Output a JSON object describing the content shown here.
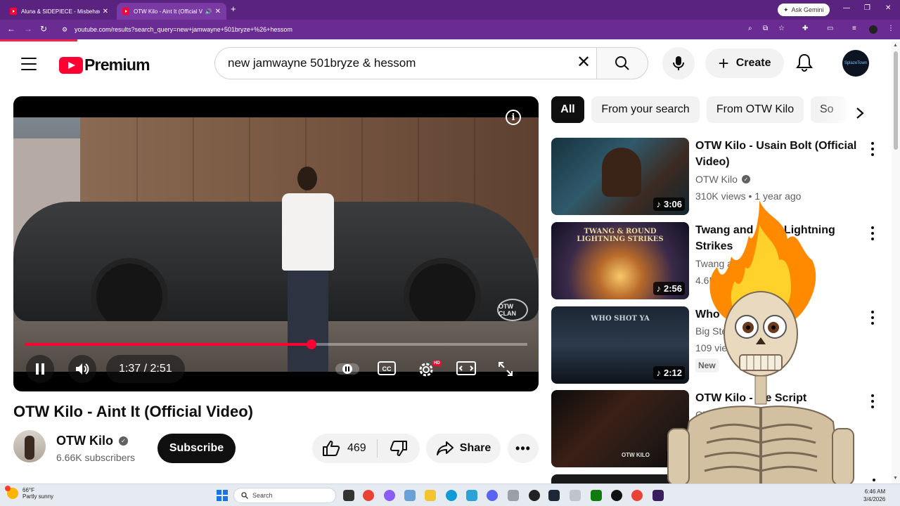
{
  "browser": {
    "tabs": [
      {
        "title": "Aluna & SIDEPIECE - Misbehavin'",
        "active": false
      },
      {
        "title": "OTW Kilo - Aint It (Official Video)",
        "active": true
      }
    ],
    "new_tab": "+",
    "ask_gemini": "Ask Gemini",
    "url": "youtube.com/results?search_query=new+jamwayne+501bryze+%26+hessom"
  },
  "youtube": {
    "brand": "Premium",
    "search_value": "new jamwayne 501bryze & hessom",
    "create_label": "Create",
    "avatar_text": "SplazeTown"
  },
  "player": {
    "time_display": "1:37 / 2:51",
    "progress_fraction": 0.57,
    "watermark": "OTW CLAN",
    "hd_badge": "HD"
  },
  "video": {
    "title": "OTW Kilo - Aint It (Official Video)",
    "channel": "OTW Kilo",
    "subscribers": "6.66K subscribers",
    "subscribe_label": "Subscribe",
    "likes": "469",
    "share_label": "Share"
  },
  "chips": [
    {
      "label": "All",
      "active": true
    },
    {
      "label": "From your search",
      "active": false
    },
    {
      "label": "From OTW Kilo",
      "active": false
    },
    {
      "label": "So",
      "active": false
    }
  ],
  "recommendations": [
    {
      "title": "OTW Kilo - Usain Bolt (Official Video)",
      "channel": "OTW Kilo",
      "verified": true,
      "meta": "310K views • 1 year ago",
      "duration": "3:06"
    },
    {
      "title": "Twang and Ro... Lightning Strikes",
      "channel": "Twang and ...",
      "verified": false,
      "meta": "4.6K view...",
      "duration": "2:56",
      "thumb_text": "TWANG & ROUND LIGHTNING STRIKES"
    },
    {
      "title": "Who Sh...",
      "channel": "Big Stev...",
      "verified": false,
      "meta": "109 views",
      "duration": "2:12",
      "badge": "New",
      "thumb_text": "WHO SHOT YA"
    },
    {
      "title": "OTW Kilo - ...e Script",
      "channel": "OTW Ki...",
      "verified": true,
      "meta": "",
      "duration": "3",
      "thumb_text": "OTW KILO"
    }
  ],
  "taskbar": {
    "temperature": "66°F",
    "condition": "Partly sunny",
    "search_label": "Search",
    "time": "6:46 AM",
    "date": "3/4/2026"
  },
  "colors": {
    "browser_frame": "#5b2380",
    "youtube_red": "#ff0033",
    "text_primary": "#0f0f0f",
    "text_secondary": "#606060"
  }
}
